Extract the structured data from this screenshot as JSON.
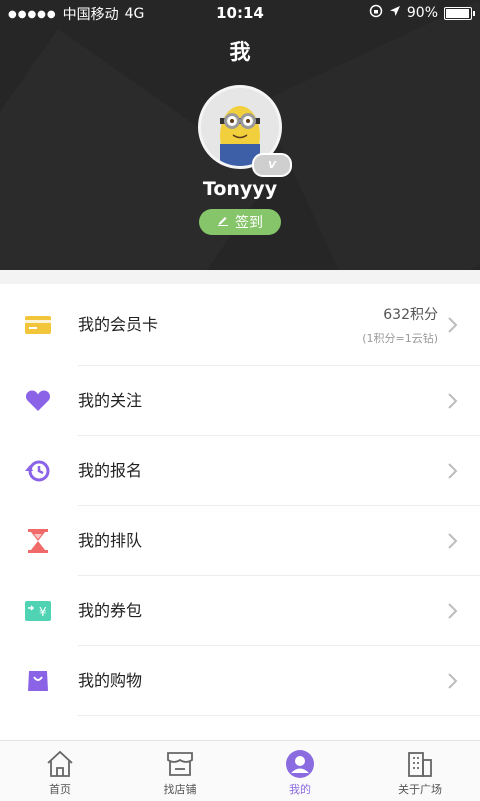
{
  "status_bar": {
    "carrier": "中国移动",
    "network": "4G",
    "time": "10:14",
    "battery": "90%",
    "battery_level": 0.9
  },
  "header": {
    "title": "我",
    "username": "Tonyyy",
    "badge": "V",
    "signin_label": "签到"
  },
  "points": {
    "value": "632积分",
    "note": "(1积分=1云钻)"
  },
  "menu": [
    {
      "label": "我的会员卡",
      "icon": "member-card-icon",
      "color": "#f3c53a"
    },
    {
      "label": "我的关注",
      "icon": "heart-icon",
      "color": "#8a63e6"
    },
    {
      "label": "我的报名",
      "icon": "history-clock-icon",
      "color": "#8a63e6"
    },
    {
      "label": "我的排队",
      "icon": "hourglass-icon",
      "color": "#f06a6a"
    },
    {
      "label": "我的券包",
      "icon": "coupon-icon",
      "color": "#4fd3b3"
    },
    {
      "label": "我的购物",
      "icon": "shopping-bag-icon",
      "color": "#8a63e6"
    }
  ],
  "tabs": [
    {
      "label": "首页",
      "icon": "home-icon"
    },
    {
      "label": "找店铺",
      "icon": "store-icon"
    },
    {
      "label": "我的",
      "icon": "profile-icon",
      "active": true
    },
    {
      "label": "关于广场",
      "icon": "building-icon"
    }
  ],
  "colors": {
    "accent": "#8a6be0",
    "signin": "#86c56a",
    "header_bg": "#262626"
  }
}
